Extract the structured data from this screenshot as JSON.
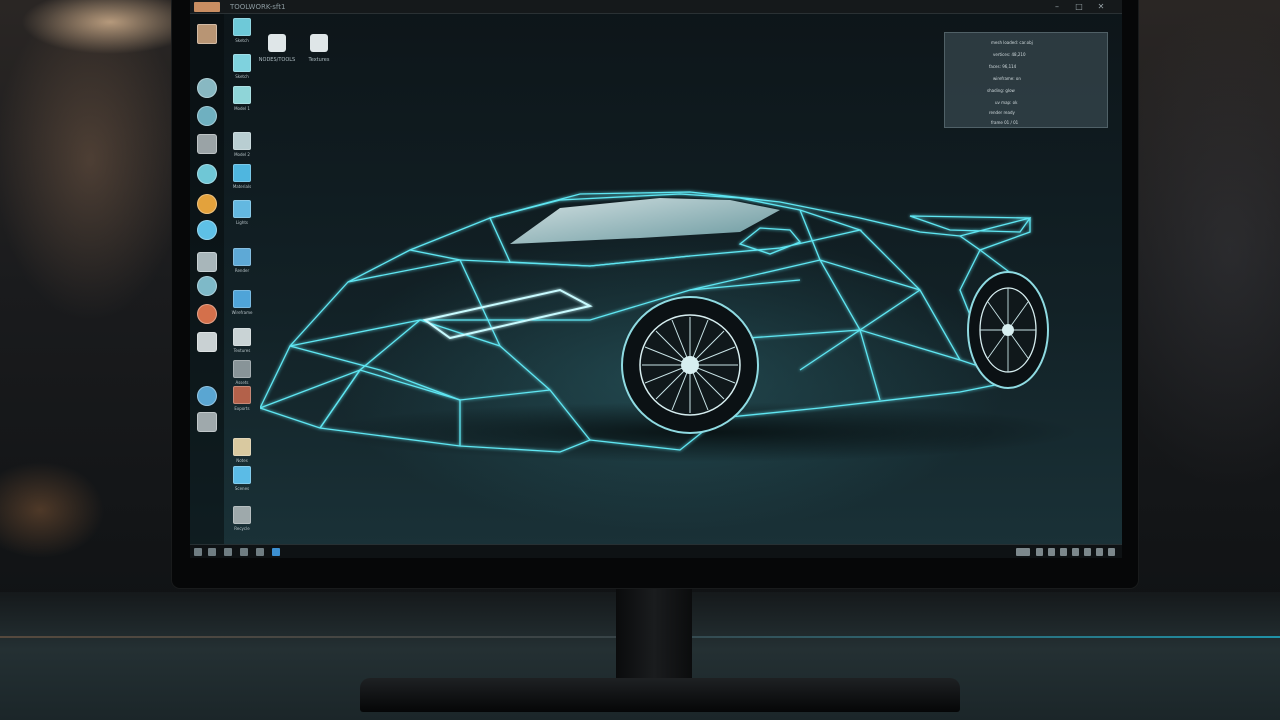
{
  "app": {
    "title": "TOOLWORK-sft1",
    "window_controls": [
      "–",
      "□",
      "✕"
    ]
  },
  "toolbar": {
    "items": [
      {
        "label": "NODES/TOOLS",
        "icon": "app-icon"
      },
      {
        "label": "Textures",
        "icon": "app-icon"
      }
    ]
  },
  "dock": {
    "icons": [
      "chrome-icon",
      "globe-icon",
      "settings-icon",
      "folder-icon",
      "firefox-icon",
      "mail-icon",
      "network-icon",
      "browser-icon",
      "media-icon",
      "layers-icon",
      "pen-icon",
      "globe-icon",
      "tool-icon"
    ]
  },
  "files": {
    "items": [
      {
        "label": "Sketch"
      },
      {
        "label": "Sketch"
      },
      {
        "label": "Model 1"
      },
      {
        "label": "Model 2"
      },
      {
        "label": "Materials"
      },
      {
        "label": "Lights"
      },
      {
        "label": "Render"
      },
      {
        "label": "Wireframe"
      },
      {
        "label": "Textures"
      },
      {
        "label": "Assets"
      },
      {
        "label": "Exports"
      },
      {
        "label": "Notes"
      },
      {
        "label": "Scenes"
      },
      {
        "label": "Recycle"
      }
    ]
  },
  "log_panel": {
    "lines": [
      "mesh loaded: car.obj",
      "vertices: 48,210",
      "faces: 96,114",
      "wireframe: on",
      "shading: glow",
      "uv map: ok",
      "render ready",
      "frame 01 / 01"
    ]
  },
  "viewport": {
    "subject": "Wireframe sports car"
  },
  "taskbar": {
    "left_icons": [
      "start-icon",
      "search-icon",
      "files-icon",
      "terminal-icon",
      "browser-icon",
      "app-icon",
      "windows-icon"
    ],
    "tray_icons": [
      "network-icon",
      "volume-icon",
      "battery-icon",
      "wifi-icon",
      "notification-icon",
      "clock-icon",
      "calendar-icon",
      "chat-icon"
    ]
  },
  "colors": {
    "accent": "#5fe6f2",
    "screen_top": "#0d1519",
    "screen_bottom": "#1a3238",
    "desk_glow": "#28c8e6"
  }
}
